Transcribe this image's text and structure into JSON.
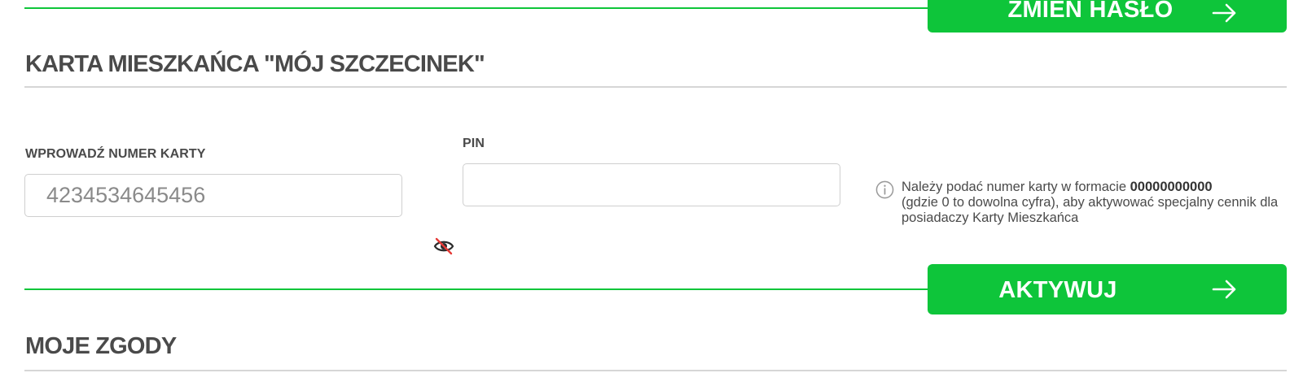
{
  "top": {
    "change_password_label": "ZMIEŃ HASŁO"
  },
  "card_section": {
    "title": "KARTA MIESZKAŃCA \"MÓJ SZCZECINEK\"",
    "card_number_label": "WPROWADŹ NUMER KARTY",
    "card_number_placeholder": "4234534645456",
    "pin_label": "PIN",
    "pin_value": "",
    "info_prefix": "Należy podać numer karty w formacie ",
    "info_format": "00000000000",
    "info_suffix": "(gdzie 0 to dowolna cyfra), aby aktywować specjalny cennik dla posiadaczy Karty Mieszkańca",
    "activate_label": "AKTYWUJ"
  },
  "consents_section": {
    "title": "MOJE ZGODY"
  },
  "icons": {
    "arrow": "arrow-right-icon",
    "visibility": "eye-off-icon",
    "info": "info-circle-icon"
  },
  "colors": {
    "accent_green": "#0ec53a",
    "text": "#4a4a4a",
    "divider": "#d6d6d6",
    "eye_off_slash": "#e53935"
  }
}
